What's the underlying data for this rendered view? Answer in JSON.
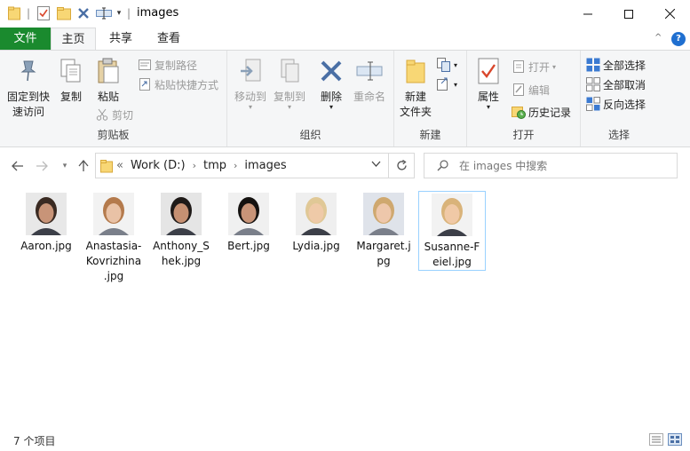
{
  "window": {
    "title": "images",
    "controls": {
      "minimize": "minimize",
      "maximize": "maximize",
      "close": "close"
    }
  },
  "tabs": {
    "file": "文件",
    "home": "主页",
    "share": "共享",
    "view": "查看"
  },
  "ribbon": {
    "clipboard": {
      "label": "剪贴板",
      "pin": "固定到快速访问",
      "copy": "复制",
      "paste": "粘贴",
      "copy_path": "复制路径",
      "paste_shortcut": "粘贴快捷方式",
      "cut": "剪切"
    },
    "organize": {
      "label": "组织",
      "move_to": "移动到",
      "copy_to": "复制到",
      "delete": "删除",
      "rename": "重命名"
    },
    "new": {
      "label": "新建",
      "new_folder": "新建文件夹"
    },
    "open": {
      "label": "打开",
      "properties": "属性",
      "open": "打开",
      "edit": "编辑",
      "history": "历史记录"
    },
    "select": {
      "label": "选择",
      "select_all": "全部选择",
      "select_none": "全部取消",
      "invert": "反向选择"
    }
  },
  "address": {
    "crumbs": [
      "Work (D:)",
      "tmp",
      "images"
    ],
    "search_placeholder": "在 images 中搜索"
  },
  "files": [
    {
      "name": "Aaron.jpg",
      "line1": "Aaron.jpg",
      "line2": "",
      "line3": ""
    },
    {
      "name": "Anastasia-Kovrizhina.jpg",
      "line1": "Anastasia-",
      "line2": "Kovrizhina",
      "line3": ".jpg"
    },
    {
      "name": "Anthony_Shek.jpg",
      "line1": "Anthony_S",
      "line2": "hek.jpg",
      "line3": ""
    },
    {
      "name": "Bert.jpg",
      "line1": "Bert.jpg",
      "line2": "",
      "line3": ""
    },
    {
      "name": "Lydia.jpg",
      "line1": "Lydia.jpg",
      "line2": "",
      "line3": ""
    },
    {
      "name": "Margaret.jpg",
      "line1": "Margaret.j",
      "line2": "pg",
      "line3": ""
    },
    {
      "name": "Susanne-Feiel.jpg",
      "line1": "Susanne-F",
      "line2": "eiel.jpg",
      "line3": ""
    }
  ],
  "status": {
    "count": "7 个项目"
  },
  "colors": {
    "file_tab": "#1a8a2e",
    "selection_border": "#99d1ff",
    "ribbon_bg": "#f5f6f7"
  }
}
